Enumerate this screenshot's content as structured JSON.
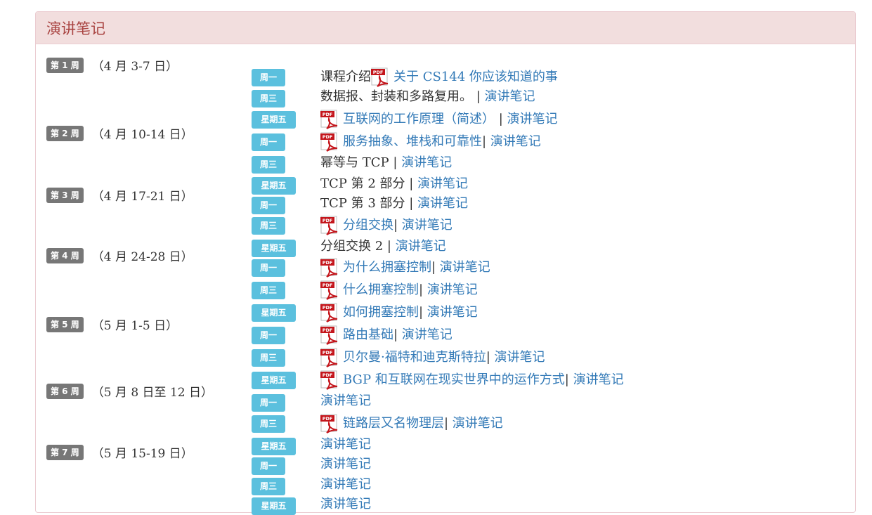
{
  "panel": {
    "title": "演讲笔记"
  },
  "weeks": [
    {
      "badge": "第 1 周",
      "dates": "（4 月 3-7 日）"
    },
    {
      "badge": "第 2 周",
      "dates": "（4 月 10-14 日）"
    },
    {
      "badge": "第 3 周",
      "dates": "（4 月 17-21 日）"
    },
    {
      "badge": "第 4 周",
      "dates": "（4 月 24-28 日）"
    },
    {
      "badge": "第 5 周",
      "dates": "（5 月 1-5 日）"
    },
    {
      "badge": "第 6 周",
      "dates": "（5 月 8 日至 12 日）"
    },
    {
      "badge": "第 7 周",
      "dates": "（5 月 15-19 日）"
    }
  ],
  "rows": [
    {
      "day": "周一",
      "pre": "课程介绍",
      "pdf": true,
      "main": "关于 CS144 你应该知道的事",
      "main_link": true,
      "sep": "",
      "notes": ""
    },
    {
      "day": "周三",
      "pre": "",
      "pdf": false,
      "main": "数据报、封装和多路复用。",
      "main_link": false,
      "sep": " | ",
      "notes": "演讲笔记"
    },
    {
      "day": "星期五",
      "pre": "",
      "pdf": true,
      "main": "互联网的工作原理（简述）",
      "main_link": true,
      "sep": " | ",
      "notes": "演讲笔记"
    },
    {
      "day": "周一",
      "pre": "",
      "pdf": true,
      "main": "服务抽象、堆栈和可靠性",
      "main_link": true,
      "sep": "| ",
      "notes": "演讲笔记"
    },
    {
      "day": "周三",
      "pre": "",
      "pdf": false,
      "main": "幂等与 TCP",
      "main_link": false,
      "sep": " | ",
      "notes": "演讲笔记"
    },
    {
      "day": "星期五",
      "pre": "",
      "pdf": false,
      "main": "TCP 第 2 部分",
      "main_link": false,
      "sep": " | ",
      "notes": "演讲笔记"
    },
    {
      "day": "周一",
      "pre": "",
      "pdf": false,
      "main": "TCP 第 3 部分",
      "main_link": false,
      "sep": " | ",
      "notes": "演讲笔记"
    },
    {
      "day": "周三",
      "pre": "",
      "pdf": true,
      "main": "分组交换",
      "main_link": true,
      "sep": "| ",
      "notes": "演讲笔记"
    },
    {
      "day": "星期五",
      "pre": "",
      "pdf": false,
      "main": "分组交换 2",
      "main_link": false,
      "sep": " | ",
      "notes": "演讲笔记"
    },
    {
      "day": "周一",
      "pre": "",
      "pdf": true,
      "main": "为什么拥塞控制",
      "main_link": true,
      "sep": "| ",
      "notes": "演讲笔记"
    },
    {
      "day": "周三",
      "pre": "",
      "pdf": true,
      "main": "什么拥塞控制",
      "main_link": true,
      "sep": "| ",
      "notes": "演讲笔记"
    },
    {
      "day": "星期五",
      "pre": "",
      "pdf": true,
      "main": "如何拥塞控制",
      "main_link": true,
      "sep": "| ",
      "notes": "演讲笔记"
    },
    {
      "day": "周一",
      "pre": "",
      "pdf": true,
      "main": "路由基础",
      "main_link": true,
      "sep": "| ",
      "notes": "演讲笔记"
    },
    {
      "day": "周三",
      "pre": "",
      "pdf": true,
      "main": "贝尔曼·福特和迪克斯特拉",
      "main_link": true,
      "sep": "| ",
      "notes": "演讲笔记"
    },
    {
      "day": "星期五",
      "pre": "",
      "pdf": true,
      "main": "BGP 和互联网在现实世界中的运作方式",
      "main_link": true,
      "sep": "| ",
      "notes": "演讲笔记"
    },
    {
      "day": "周一",
      "pre": "",
      "pdf": false,
      "main": "",
      "main_link": false,
      "sep": "",
      "notes": "演讲笔记"
    },
    {
      "day": "周三",
      "pre": "",
      "pdf": true,
      "main": "链路层又名物理层",
      "main_link": true,
      "sep": "| ",
      "notes": "演讲笔记"
    },
    {
      "day": "星期五",
      "pre": "",
      "pdf": false,
      "main": "",
      "main_link": false,
      "sep": "",
      "notes": "演讲笔记"
    },
    {
      "day": "周一",
      "pre": "",
      "pdf": false,
      "main": "",
      "main_link": false,
      "sep": "",
      "notes": "演讲笔记"
    },
    {
      "day": "周三",
      "pre": "",
      "pdf": false,
      "main": "",
      "main_link": false,
      "sep": "",
      "notes": "演讲笔记"
    },
    {
      "day": "星期五",
      "pre": "",
      "pdf": false,
      "main": "",
      "main_link": false,
      "sep": "",
      "notes": "演讲笔记"
    }
  ],
  "pdf_icon_label": "PDF",
  "colors": {
    "heading_bg": "#f2dede",
    "heading_text": "#a94442",
    "panel_border": "#ebccd1",
    "week_badge": "#777777",
    "day_badge": "#5bc0de",
    "link": "#337ab7",
    "pdf_red": "#c4161c"
  }
}
